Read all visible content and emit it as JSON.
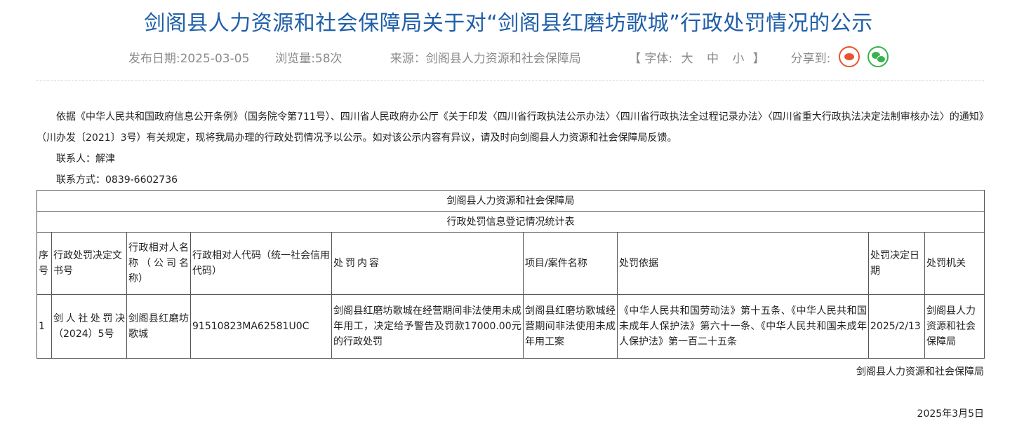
{
  "page": {
    "title": "剑阁县人力资源和社会保障局关于对“剑阁县红磨坊歌城”行政处罚情况的公示"
  },
  "meta": {
    "publish_date": "发布日期:2025-03-05",
    "views": "浏览量:58次",
    "source": "来源：剑阁县人力资源和社会保障局",
    "font_bracket_open": "【 字体:",
    "font_large": "大",
    "font_medium": "中",
    "font_small": "小",
    "font_bracket_close": "】",
    "share_label": "分享到:",
    "share_icons": [
      "weibo-icon",
      "wechat-icon"
    ],
    "colors": {
      "title": "#1f5fa8",
      "weibo": "#e8542f",
      "wechat": "#35b34a"
    }
  },
  "body": {
    "paragraph": "依据《中华人民共和国政府信息公开条例》（国务院令第711号）、四川省人民政府办公厅《关于印发〈四川省行政执法公示办法〉〈四川省行政执法全过程记录办法〉〈四川省重大行政执法决定法制审核办法〉的通知》（川办发〔2021〕3号）有关规定，现将我局办理的行政处罚情况予以公示。如对该公示内容有异议，请及时向剑阁县人力资源和社会保障局反馈。",
    "contact_person": "联系人：解津",
    "contact_phone": "联系方式：0839-6602736"
  },
  "table": {
    "caption_line1": "剑阁县人力资源和社会保障局",
    "caption_line2": "行政处罚信息登记情况统计表",
    "headers": {
      "seq": "序号",
      "doc_no": "行政处罚决定文书号",
      "party_name": "行政相对人名称（公司名称）",
      "party_code": "行政相对人代码（统一社会信用代码）",
      "content": "处罚内容",
      "case_name": "项目/案件名称",
      "basis": "处罚依据",
      "decision_date": "处罚决定日期",
      "authority": "处罚机关"
    },
    "rows": [
      {
        "seq": "1",
        "doc_no": "剑人社处罚决（2024）5号",
        "party_name": "剑阁县红磨坊歌城",
        "party_code": "91510823MA62581U0C",
        "content": "剑阁县红磨坊歌城在经营期间非法使用未成年用工，决定给予警告及罚款17000.00元的行政处罚",
        "case_name": "剑阁县红磨坊歌城经营期间非法使用未成年用工案",
        "basis": "《中华人民共和国劳动法》第十五条、《中华人民共和国未成年人保护法》第六十一条、《中华人民共和国未成年人保护法》第一百二十五条",
        "decision_date": "2025/2/13",
        "authority": "剑阁县人力资源和社会保障局"
      }
    ]
  },
  "footer": {
    "signature": "剑阁县人力资源和社会保障局",
    "date": "2025年3月5日"
  }
}
